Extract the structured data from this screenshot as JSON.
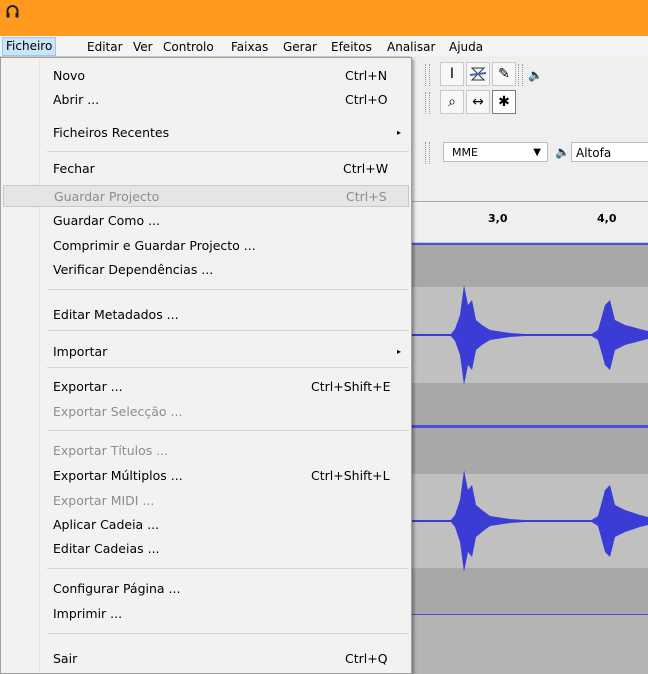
{
  "menubar": {
    "items": [
      "Ficheiro",
      "Editar",
      "Ver",
      "Controlo",
      "Faixas",
      "Gerar",
      "Efeitos",
      "Analisar",
      "Ajuda"
    ]
  },
  "file_menu": {
    "items": [
      {
        "label": "Novo",
        "shortcut": "Ctrl+N"
      },
      {
        "label": "Abrir ...",
        "shortcut": "Ctrl+O"
      },
      {
        "label": "Ficheiros Recentes",
        "submenu": true
      },
      {
        "label": "Fechar",
        "shortcut": "Ctrl+W"
      },
      {
        "label": "Guardar Projecto",
        "shortcut": "Ctrl+S",
        "disabled": true,
        "highlighted": true
      },
      {
        "label": "Guardar Como ..."
      },
      {
        "label": "Comprimir e Guardar Projecto ..."
      },
      {
        "label": "Verificar Dependências ..."
      },
      {
        "label": "Editar Metadados ..."
      },
      {
        "label": "Importar",
        "submenu": true
      },
      {
        "label": "Exportar ...",
        "shortcut": "Ctrl+Shift+E"
      },
      {
        "label": "Exportar Selecção ...",
        "disabled": true
      },
      {
        "label": "Exportar Títulos ...",
        "disabled": true
      },
      {
        "label": "Exportar Múltiplos ...",
        "shortcut": "Ctrl+Shift+L"
      },
      {
        "label": "Exportar MIDI ...",
        "disabled": true
      },
      {
        "label": "Aplicar Cadeia ..."
      },
      {
        "label": "Editar Cadeias ..."
      },
      {
        "label": "Configurar Página ..."
      },
      {
        "label": "Imprimir ..."
      },
      {
        "label": "Sair",
        "shortcut": "Ctrl+Q"
      }
    ],
    "submenu_arrow": "▸"
  },
  "toolbar": {
    "device_host": "MME",
    "output_label": "Altofa",
    "tools": [
      "ibeam-icon",
      "envelope-icon",
      "pencil-icon",
      "zoom-icon",
      "timeshift-icon",
      "multitool-icon"
    ]
  },
  "ruler": {
    "ticks": [
      "3,0",
      "4,0"
    ]
  },
  "colors": {
    "titlebar": "#ff9a1f",
    "waveform": "#3b3bd6",
    "track_border": "#4d4dd8"
  }
}
